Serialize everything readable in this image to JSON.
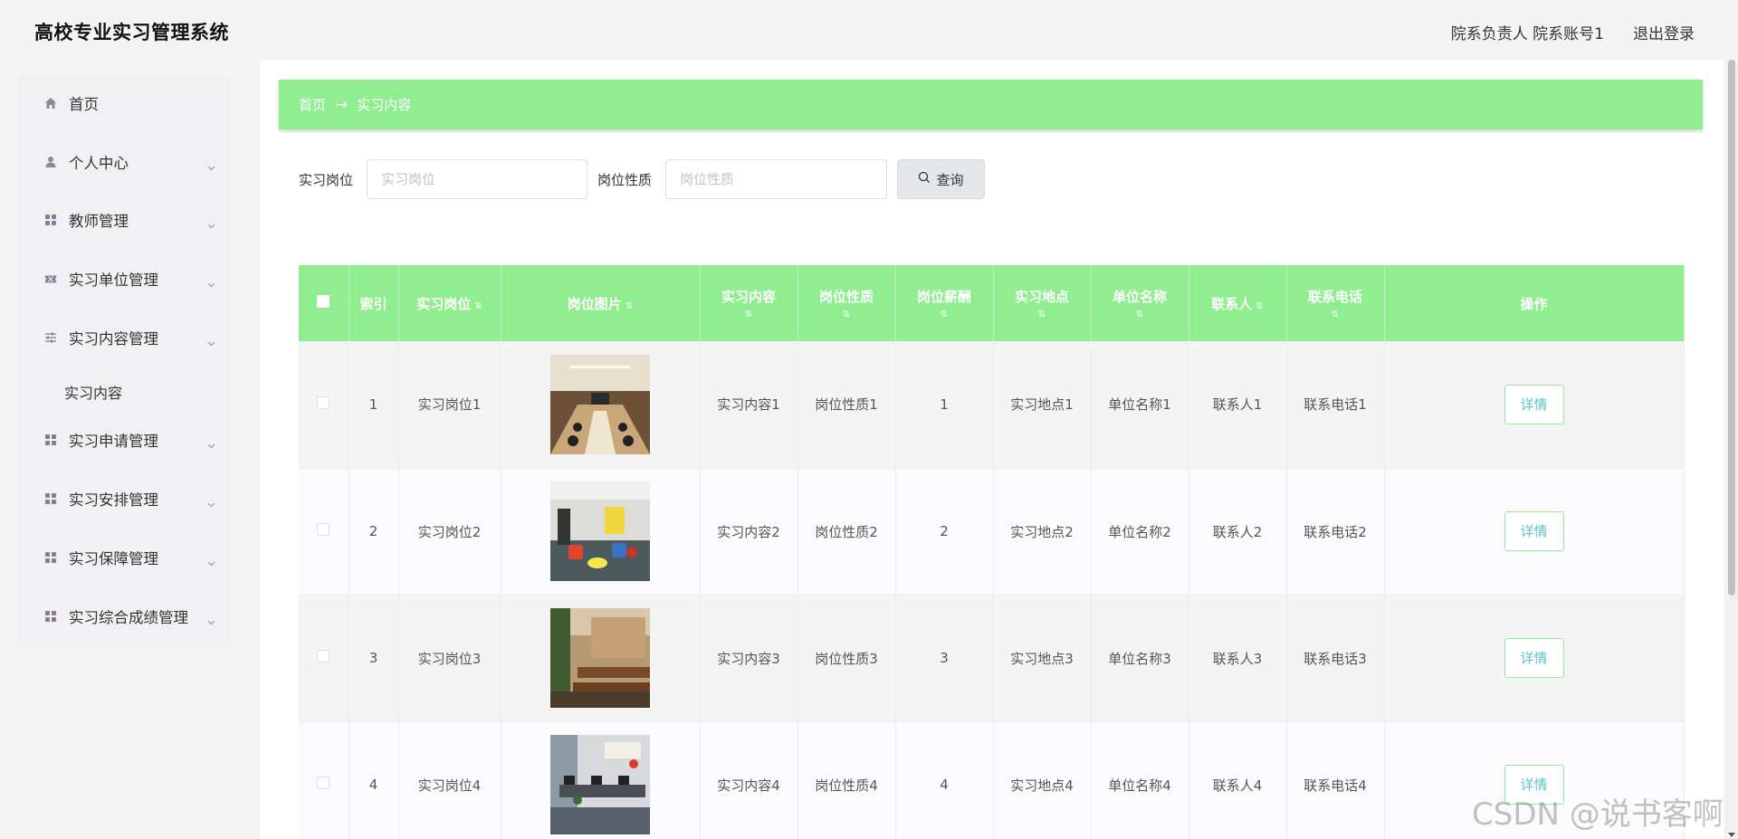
{
  "app": {
    "title": "高校专业实习管理系统"
  },
  "header": {
    "user": "院系负责人 院系账号1",
    "logout": "退出登录"
  },
  "sidebar": {
    "items": [
      {
        "label": "首页",
        "icon": "home-icon"
      },
      {
        "label": "个人中心",
        "icon": "user-icon"
      },
      {
        "label": "教师管理",
        "icon": "grid-icon"
      },
      {
        "label": "实习单位管理",
        "icon": "ticket-icon"
      },
      {
        "label": "实习内容管理",
        "icon": "sliders-icon"
      },
      {
        "label": "实习申请管理",
        "icon": "grid-icon"
      },
      {
        "label": "实习安排管理",
        "icon": "grid-icon"
      },
      {
        "label": "实习保障管理",
        "icon": "grid-icon"
      },
      {
        "label": "实习综合成绩管理",
        "icon": "grid-icon"
      }
    ],
    "submenu": {
      "label": "实习内容"
    }
  },
  "breadcrumb": {
    "home": "首页",
    "separator": "→",
    "current": "实习内容"
  },
  "filters": {
    "position_label": "实习岗位",
    "position_placeholder": "实习岗位",
    "nature_label": "岗位性质",
    "nature_placeholder": "岗位性质",
    "search_button": "查询"
  },
  "table": {
    "headers": [
      "索引",
      "实习岗位",
      "岗位图片",
      "实习内容",
      "岗位性质",
      "岗位薪酬",
      "实习地点",
      "单位名称",
      "联系人",
      "联系电话",
      "操作"
    ],
    "rows": [
      {
        "index": "1",
        "position": "实习岗位1",
        "content": "实习内容1",
        "nature": "岗位性质1",
        "salary": "1",
        "location": "实习地点1",
        "unit": "单位名称1",
        "contact": "联系人1",
        "phone": "联系电话1",
        "action": "详情"
      },
      {
        "index": "2",
        "position": "实习岗位2",
        "content": "实习内容2",
        "nature": "岗位性质2",
        "salary": "2",
        "location": "实习地点2",
        "unit": "单位名称2",
        "contact": "联系人2",
        "phone": "联系电话2",
        "action": "详情"
      },
      {
        "index": "3",
        "position": "实习岗位3",
        "content": "实习内容3",
        "nature": "岗位性质3",
        "salary": "3",
        "location": "实习地点3",
        "unit": "单位名称3",
        "contact": "联系人3",
        "phone": "联系电话3",
        "action": "详情"
      },
      {
        "index": "4",
        "position": "实习岗位4",
        "content": "实习内容4",
        "nature": "岗位性质4",
        "salary": "4",
        "location": "实习地点4",
        "unit": "单位名称4",
        "contact": "联系人4",
        "phone": "联系电话4",
        "action": "详情"
      }
    ]
  },
  "watermark": "CSDN @说书客啊",
  "colors": {
    "accent": "#90ee90",
    "detail_text": "#5cc4c4",
    "background": "#f4f4f5"
  }
}
